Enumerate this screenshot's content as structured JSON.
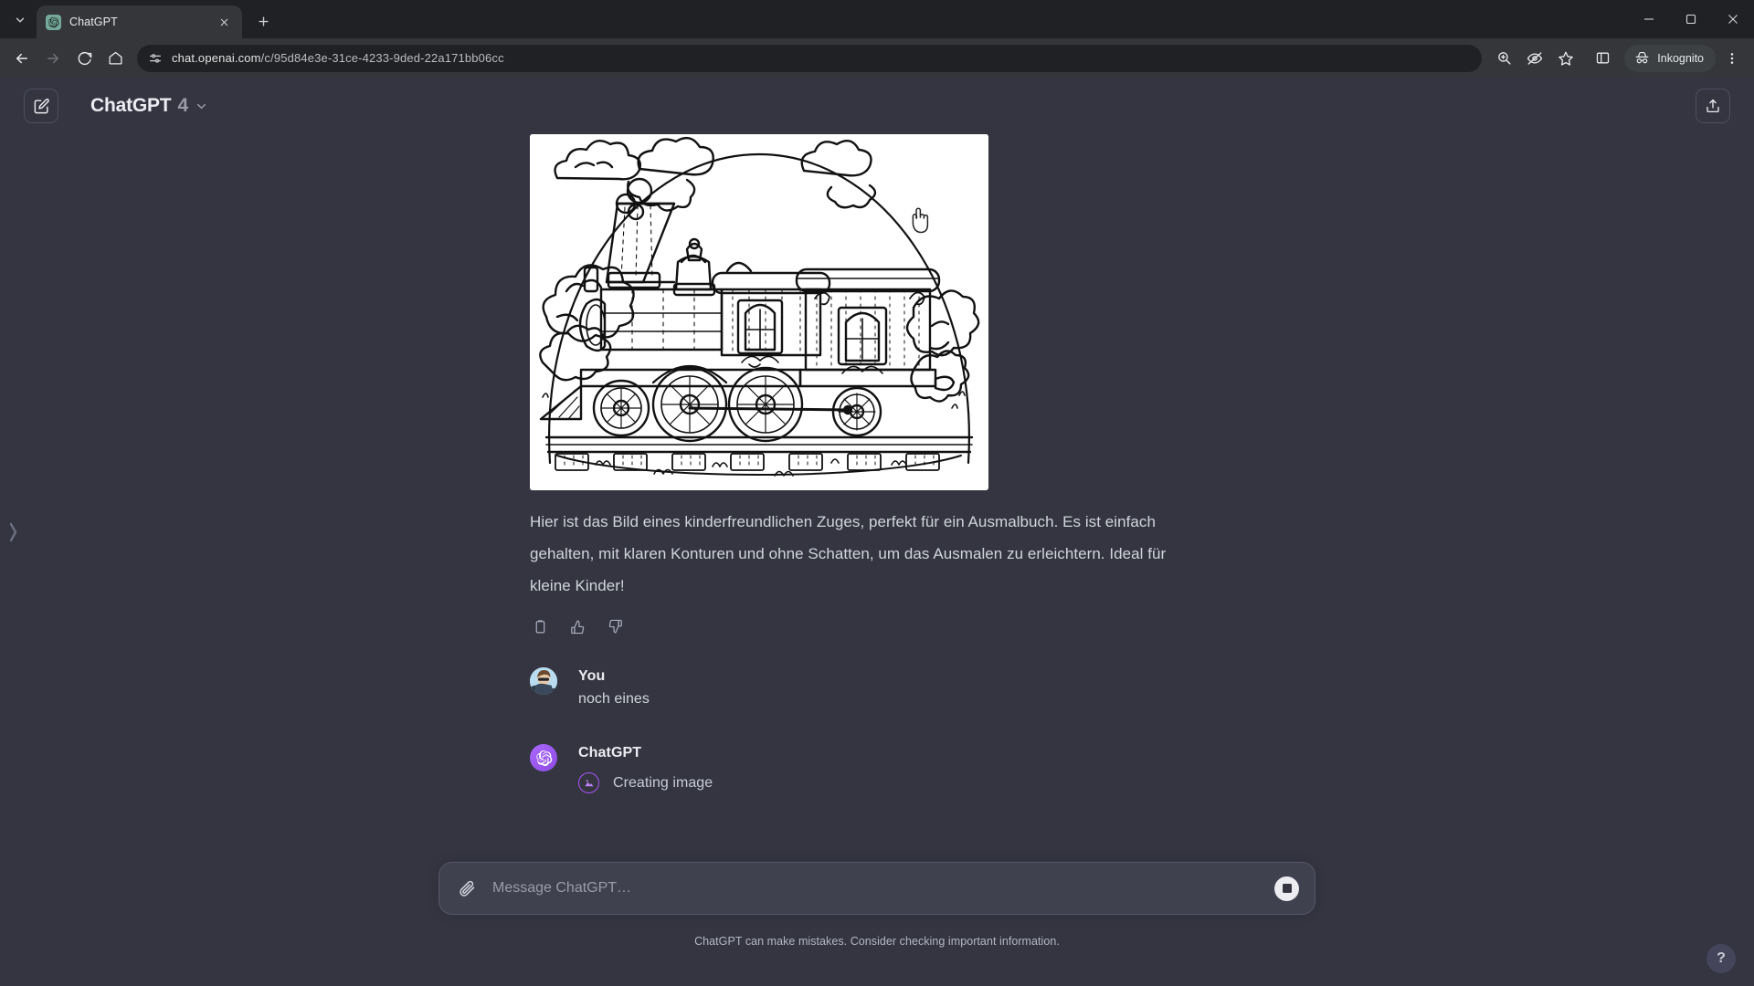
{
  "browser": {
    "tab": {
      "title": "ChatGPT",
      "favicon": "chatgpt-logo-icon"
    },
    "new_tab_label": "+",
    "url_host": "chat.openai.com",
    "url_path": "/c/95d84e3e-31ce-4233-9ded-22a171bb06cc",
    "full_url": "chat.openai.com/c/95d84e3e-31ce-4233-9ded-22a171bb06cc",
    "incognito_label": "Inkognito",
    "toolbar_icons": [
      "zoom-in-icon",
      "eye-slash-icon",
      "star-icon",
      "side-panel-icon",
      "three-dot-menu-icon"
    ],
    "nav_icons": [
      "back-arrow-icon",
      "forward-arrow-icon",
      "reload-icon",
      "home-icon"
    ],
    "site_info_icon": "page-settings-icon",
    "window_controls": [
      "minimize",
      "maximize",
      "close"
    ]
  },
  "app": {
    "new_chat_icon": "compose-pencil-icon",
    "model_name": "ChatGPT",
    "model_version": "4",
    "model_chevron": "chevron-down-icon",
    "share_icon": "share-upload-icon",
    "sidebar_handle_icon": "chevron-right-icon",
    "help_label": "?"
  },
  "conversation": {
    "assistant_message": {
      "image_alt": "coloring-book line art of a steam train with clouds, trees and track",
      "text": "Hier ist das Bild eines kinderfreundlichen Zuges, perfekt für ein Ausmalbuch. Es ist einfach gehalten, mit klaren Konturen und ohne Schatten, um das Ausmalen zu erleichtern. Ideal für kleine Kinder!",
      "actions": [
        {
          "name": "copy-icon",
          "label": "Copy"
        },
        {
          "name": "thumbs-up-icon",
          "label": "Good response"
        },
        {
          "name": "thumbs-down-icon",
          "label": "Bad response"
        }
      ]
    },
    "user_message": {
      "name": "You",
      "text": "noch eines",
      "avatar": "user-photo-avatar"
    },
    "pending_message": {
      "name": "ChatGPT",
      "avatar": "openai-logo-avatar",
      "tool_icon": "image-mountain-icon",
      "tool_status": "Creating image"
    }
  },
  "composer": {
    "attach_icon": "paperclip-icon",
    "placeholder": "Message ChatGPT…",
    "value": "",
    "stop_icon": "stop-square-icon",
    "disclaimer": "ChatGPT can make mistakes. Consider checking important information."
  },
  "colors": {
    "page_bg": "#343541",
    "composer_bg": "#40414f",
    "chrome_bg": "#202124",
    "toolbar_bg": "#35363a",
    "accent_purple": "#ab68ff",
    "tool_purple": "#a855f7",
    "text_primary": "#ececf1",
    "text_secondary": "#d1d5db"
  }
}
